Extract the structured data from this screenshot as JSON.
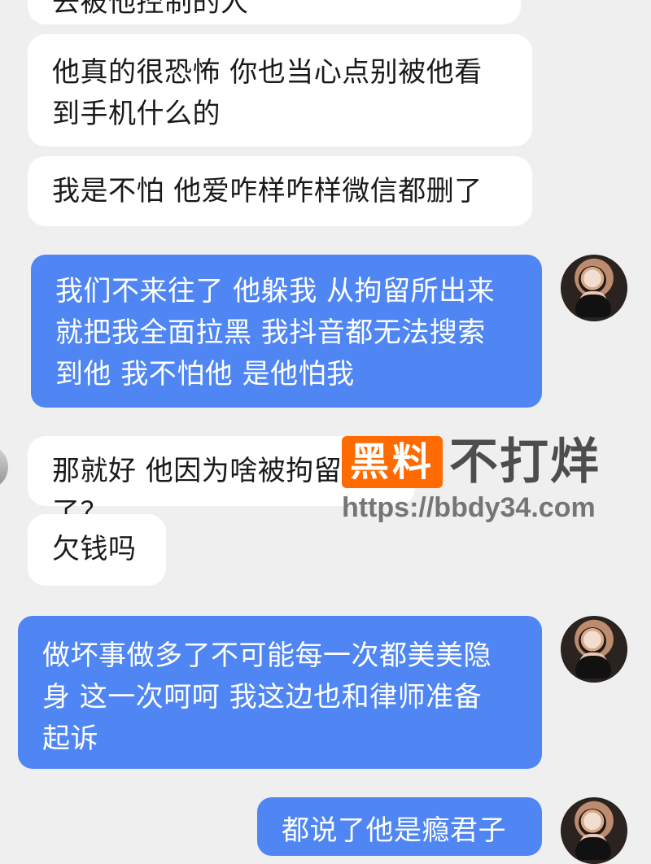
{
  "messages": [
    {
      "id": 1,
      "side": "incoming",
      "text": "去被他控制的人"
    },
    {
      "id": 2,
      "side": "incoming",
      "text": "他真的很恐怖 你也当心点别被他看\n到手机什么的"
    },
    {
      "id": 3,
      "side": "incoming",
      "text": "我是不怕 他爱咋样咋样微信都删了"
    },
    {
      "id": 4,
      "side": "outgoing",
      "text": "我们不来往了 他躲我 从拘留所出来\n就把我全面拉黑 我抖音都无法搜索\n到他 我不怕他 是他怕我"
    },
    {
      "id": 5,
      "side": "incoming",
      "text": "那就好 他因为啥被拘留了？"
    },
    {
      "id": 6,
      "side": "incoming",
      "text": "欠钱吗"
    },
    {
      "id": 7,
      "side": "outgoing",
      "text": "做坏事做多了不可能每一次都美美隐\n身 这一次呵呵 我这边也和律师准备\n起诉"
    },
    {
      "id": 8,
      "side": "outgoing",
      "text": "都说了他是瘾君子"
    }
  ],
  "watermark": {
    "badge": "黑料",
    "text": "不打烊",
    "url": "https://bbdy34.com"
  }
}
